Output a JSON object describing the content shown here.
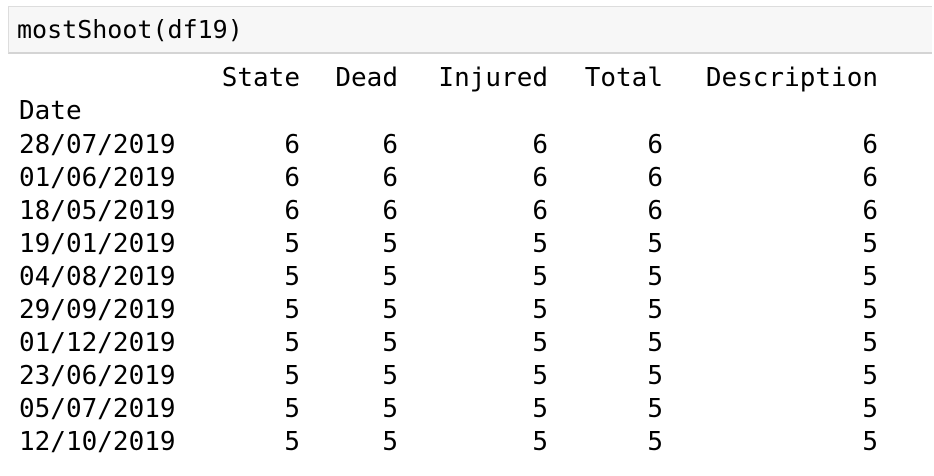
{
  "code_cell": {
    "source": "mostShoot(df19)"
  },
  "output_table": {
    "columns": [
      "State",
      "Dead",
      "Injured",
      "Total",
      "Description"
    ],
    "index_name": "Date",
    "rows": [
      {
        "date": "28/07/2019",
        "values": [
          "6",
          "6",
          "6",
          "6",
          "6"
        ]
      },
      {
        "date": "01/06/2019",
        "values": [
          "6",
          "6",
          "6",
          "6",
          "6"
        ]
      },
      {
        "date": "18/05/2019",
        "values": [
          "6",
          "6",
          "6",
          "6",
          "6"
        ]
      },
      {
        "date": "19/01/2019",
        "values": [
          "5",
          "5",
          "5",
          "5",
          "5"
        ]
      },
      {
        "date": "04/08/2019",
        "values": [
          "5",
          "5",
          "5",
          "5",
          "5"
        ]
      },
      {
        "date": "29/09/2019",
        "values": [
          "5",
          "5",
          "5",
          "5",
          "5"
        ]
      },
      {
        "date": "01/12/2019",
        "values": [
          "5",
          "5",
          "5",
          "5",
          "5"
        ]
      },
      {
        "date": "23/06/2019",
        "values": [
          "5",
          "5",
          "5",
          "5",
          "5"
        ]
      },
      {
        "date": "05/07/2019",
        "values": [
          "5",
          "5",
          "5",
          "5",
          "5"
        ]
      },
      {
        "date": "12/10/2019",
        "values": [
          "5",
          "5",
          "5",
          "5",
          "5"
        ]
      }
    ]
  }
}
